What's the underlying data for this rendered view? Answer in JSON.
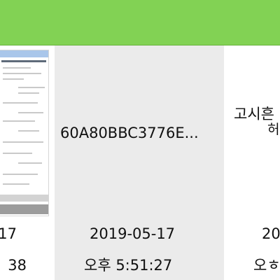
{
  "files": [
    {
      "name": "",
      "date": "17",
      "time": "38"
    },
    {
      "name": "60A80BBC3776E...",
      "date": "2019-05-17",
      "time": "오후 5:51:27"
    },
    {
      "name_line1": "고시흔",
      "name_line2": "허",
      "date": "20",
      "time": "오ㅎ"
    }
  ]
}
